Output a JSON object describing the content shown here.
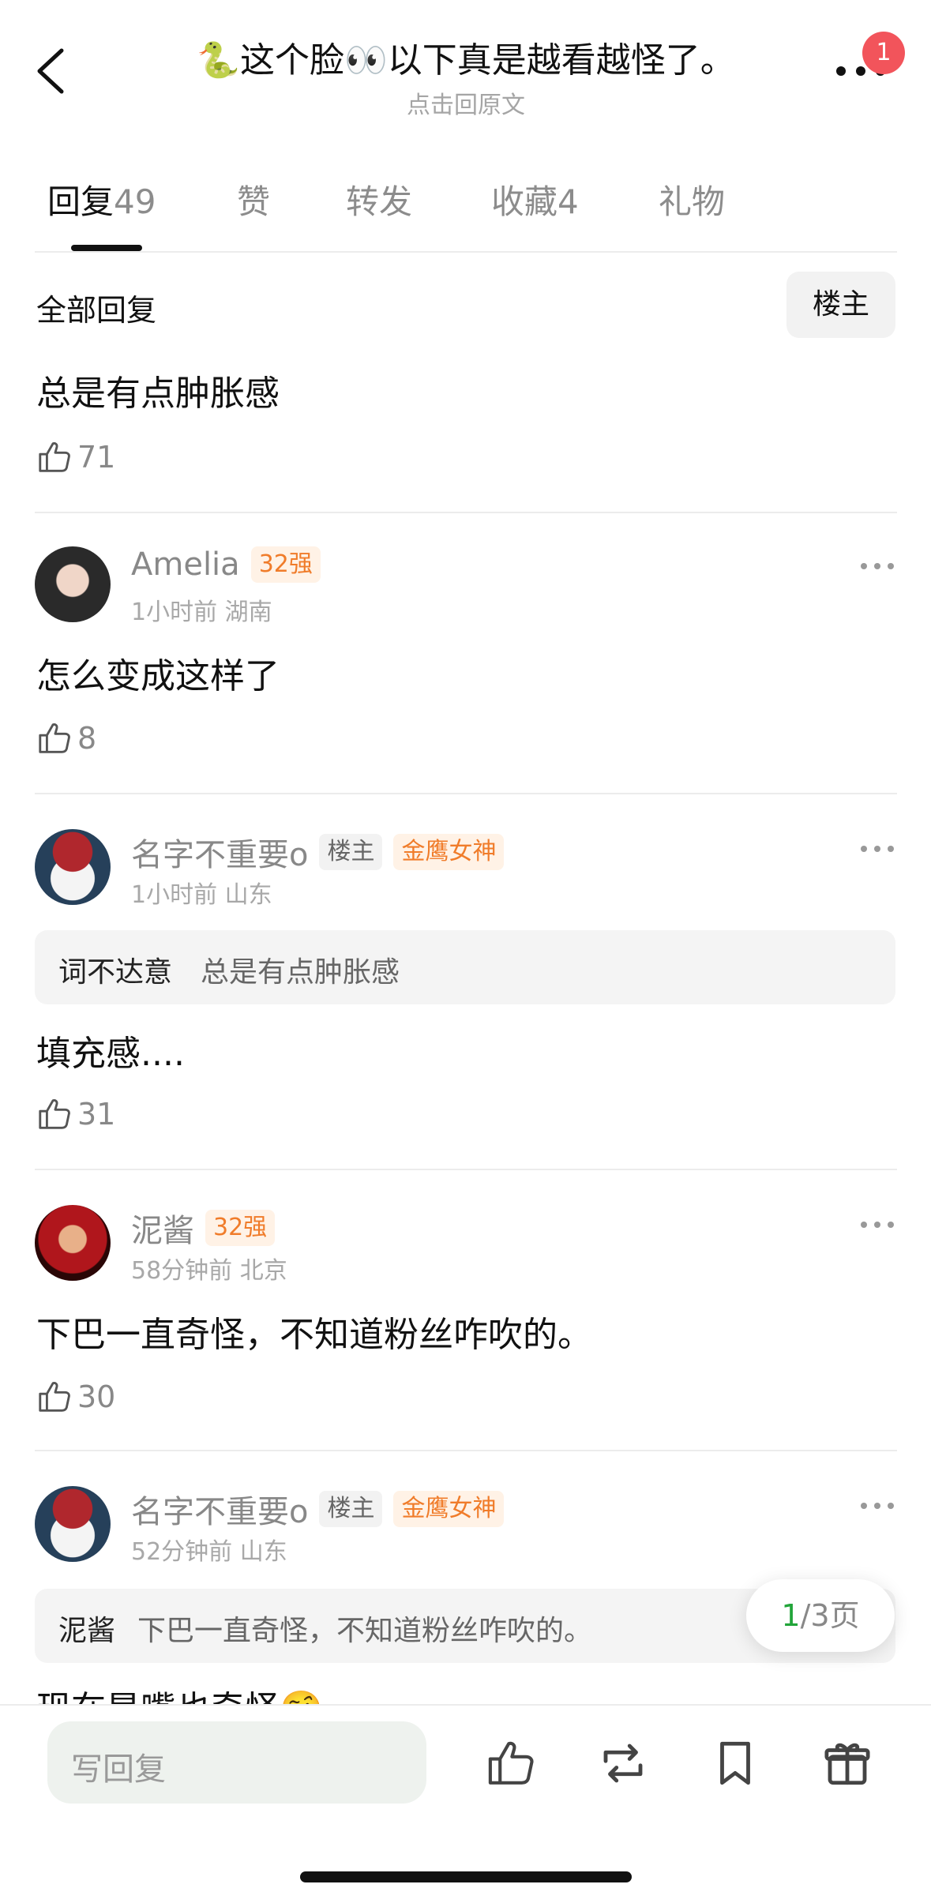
{
  "header": {
    "title": "🐍这个脸👀以下真是越看越怪了。",
    "subtitle": "点击回原文",
    "notification_count": "1"
  },
  "tabs": [
    {
      "label": "回复",
      "count": "49"
    },
    {
      "label": "赞",
      "count": ""
    },
    {
      "label": "转发",
      "count": ""
    },
    {
      "label": "收藏",
      "count": "4"
    },
    {
      "label": "礼物",
      "count": ""
    }
  ],
  "filter": {
    "all_label": "全部回复",
    "owner_label": "楼主"
  },
  "top_comment": {
    "text": "总是有点肿胀感",
    "likes": "71"
  },
  "comments": [
    {
      "name": "Amelia",
      "rank": "32强",
      "meta": "1小时前 湖南",
      "text": "怎么变成这样了",
      "likes": "8"
    },
    {
      "name": "名字不重要o",
      "op_tag": "楼主",
      "title_tag": "金鹰女神",
      "meta": "1小时前 山东",
      "quote_name": "词不达意",
      "quote_text": "总是有点肿胀感",
      "text": "填充感....",
      "likes": "31"
    },
    {
      "name": "泥酱",
      "rank": "32强",
      "meta": "58分钟前 北京",
      "text": "下巴一直奇怪，不知道粉丝咋吹的。",
      "likes": "30"
    },
    {
      "name": "名字不重要o",
      "op_tag": "楼主",
      "title_tag": "金鹰女神",
      "meta": "52分钟前 山东",
      "quote_name": "泥酱",
      "quote_text": "下巴一直奇怪，不知道粉丝咋吹的。",
      "text": "现在是嘴也奇怪🤨"
    }
  ],
  "pager": {
    "current": "1",
    "total": "/3页"
  },
  "bottom": {
    "reply_placeholder": "写回复"
  },
  "colors": {
    "accent_orange": "#f07c2a",
    "badge_red": "#f2545b",
    "pager_green": "#22a53a"
  }
}
